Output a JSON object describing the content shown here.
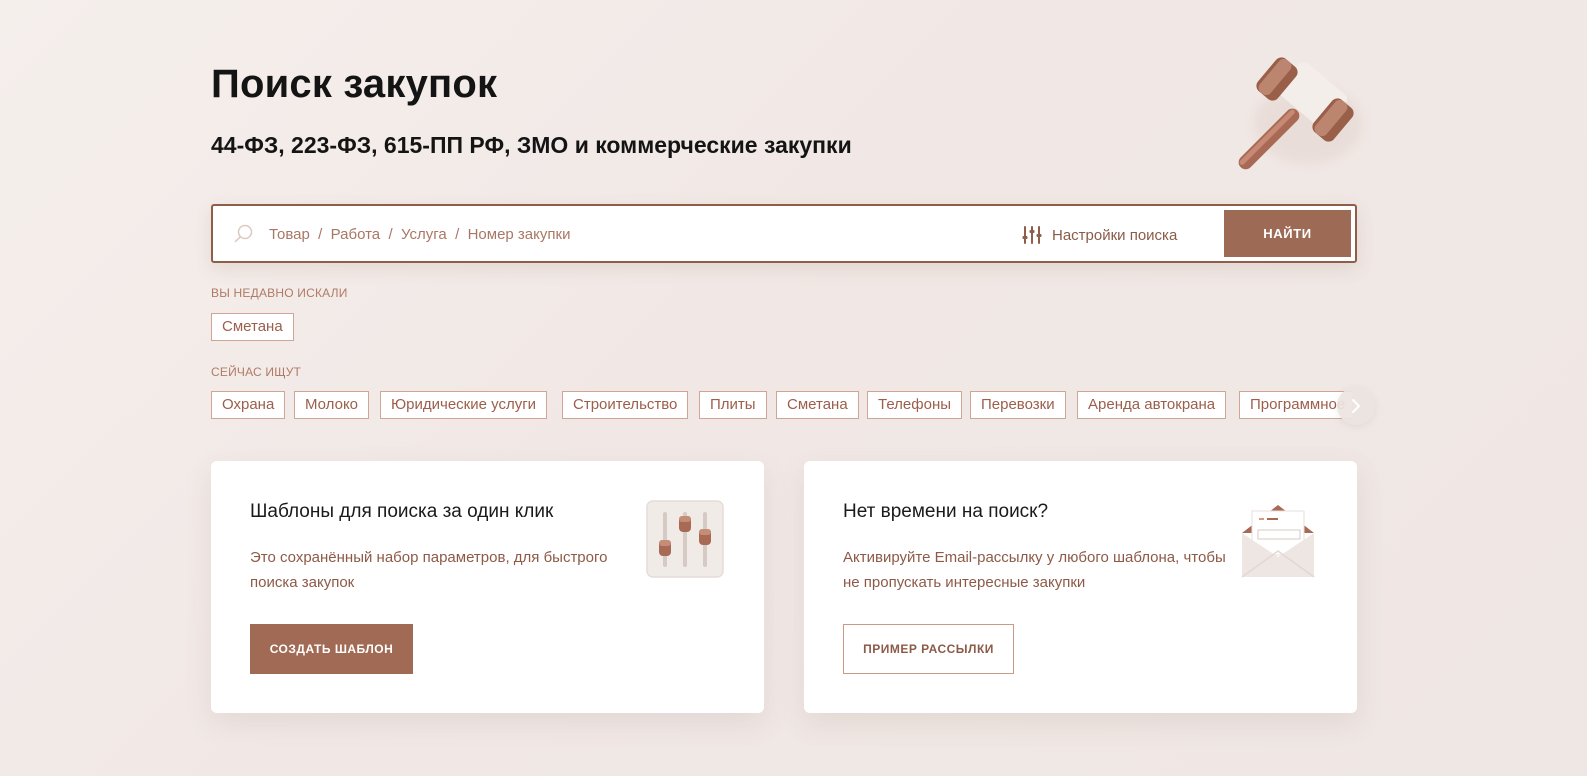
{
  "header": {
    "title": "Поиск закупок",
    "subtitle": "44-ФЗ, 223-ФЗ, 615-ПП РФ, ЗМО и коммерческие закупки",
    "illustration": "gavel-icon"
  },
  "search": {
    "placeholder": "Товар  /  Работа  /  Услуга  /  Номер закупки",
    "value": "",
    "settings_label": "Настройки поиска",
    "submit_label": "НАЙТИ",
    "icons": {
      "search": "search-icon",
      "settings": "sliders-icon"
    }
  },
  "recent": {
    "label": "ВЫ НЕДАВНО ИСКАЛИ",
    "tags": [
      "Сметана"
    ]
  },
  "trending": {
    "label": "СЕЙЧАС ИЩУТ",
    "tags": [
      "Охрана",
      "Молоко",
      "Юридические услуги",
      "Строительство",
      "Плиты",
      "Сметана",
      "Телефоны",
      "Перевозки",
      "Аренда автокрана",
      "Программное"
    ],
    "next_icon": "chevron-right-icon"
  },
  "cards": {
    "templates": {
      "title": "Шаблоны для поиска за один клик",
      "text": "Это сохранённый набор параметров, для быстрого поиска закупок",
      "button_label": "СОЗДАТЬ ШАБЛОН",
      "illustration": "equalizer-icon"
    },
    "mailing": {
      "title": "Нет времени на поиск?",
      "text": "Активируйте Email-рассылку у любого шаблона, чтобы не пропускать интересные закупки",
      "button_label": "ПРИМЕР РАССЫЛКИ",
      "illustration": "envelope-icon"
    }
  },
  "colors": {
    "accent": "#9d6a55",
    "accent_dark": "#8e5e4b",
    "tag_text": "#9b5f4c",
    "tag_border": "#d0a595",
    "background": "#f3ece9"
  }
}
